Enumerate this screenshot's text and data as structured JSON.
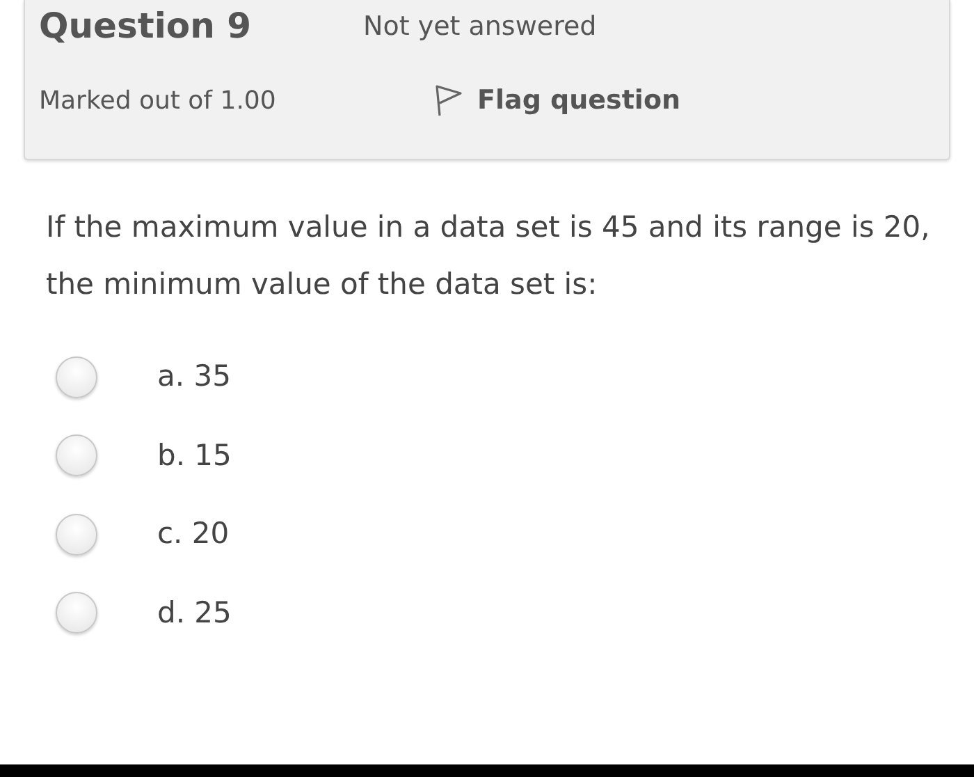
{
  "question": {
    "title": "Question 9",
    "status": "Not yet answered",
    "marks": "Marked out of 1.00",
    "flag": {
      "label": "Flag question",
      "flagged": false
    }
  },
  "text": "If the maximum value in a data set is 45 and its range is 20, the minimum value of the data set is:",
  "options": [
    {
      "label": "a. 35",
      "selected": false
    },
    {
      "label": "b. 15",
      "selected": false
    },
    {
      "label": "c. 20",
      "selected": false
    },
    {
      "label": "d. 25",
      "selected": false
    }
  ]
}
